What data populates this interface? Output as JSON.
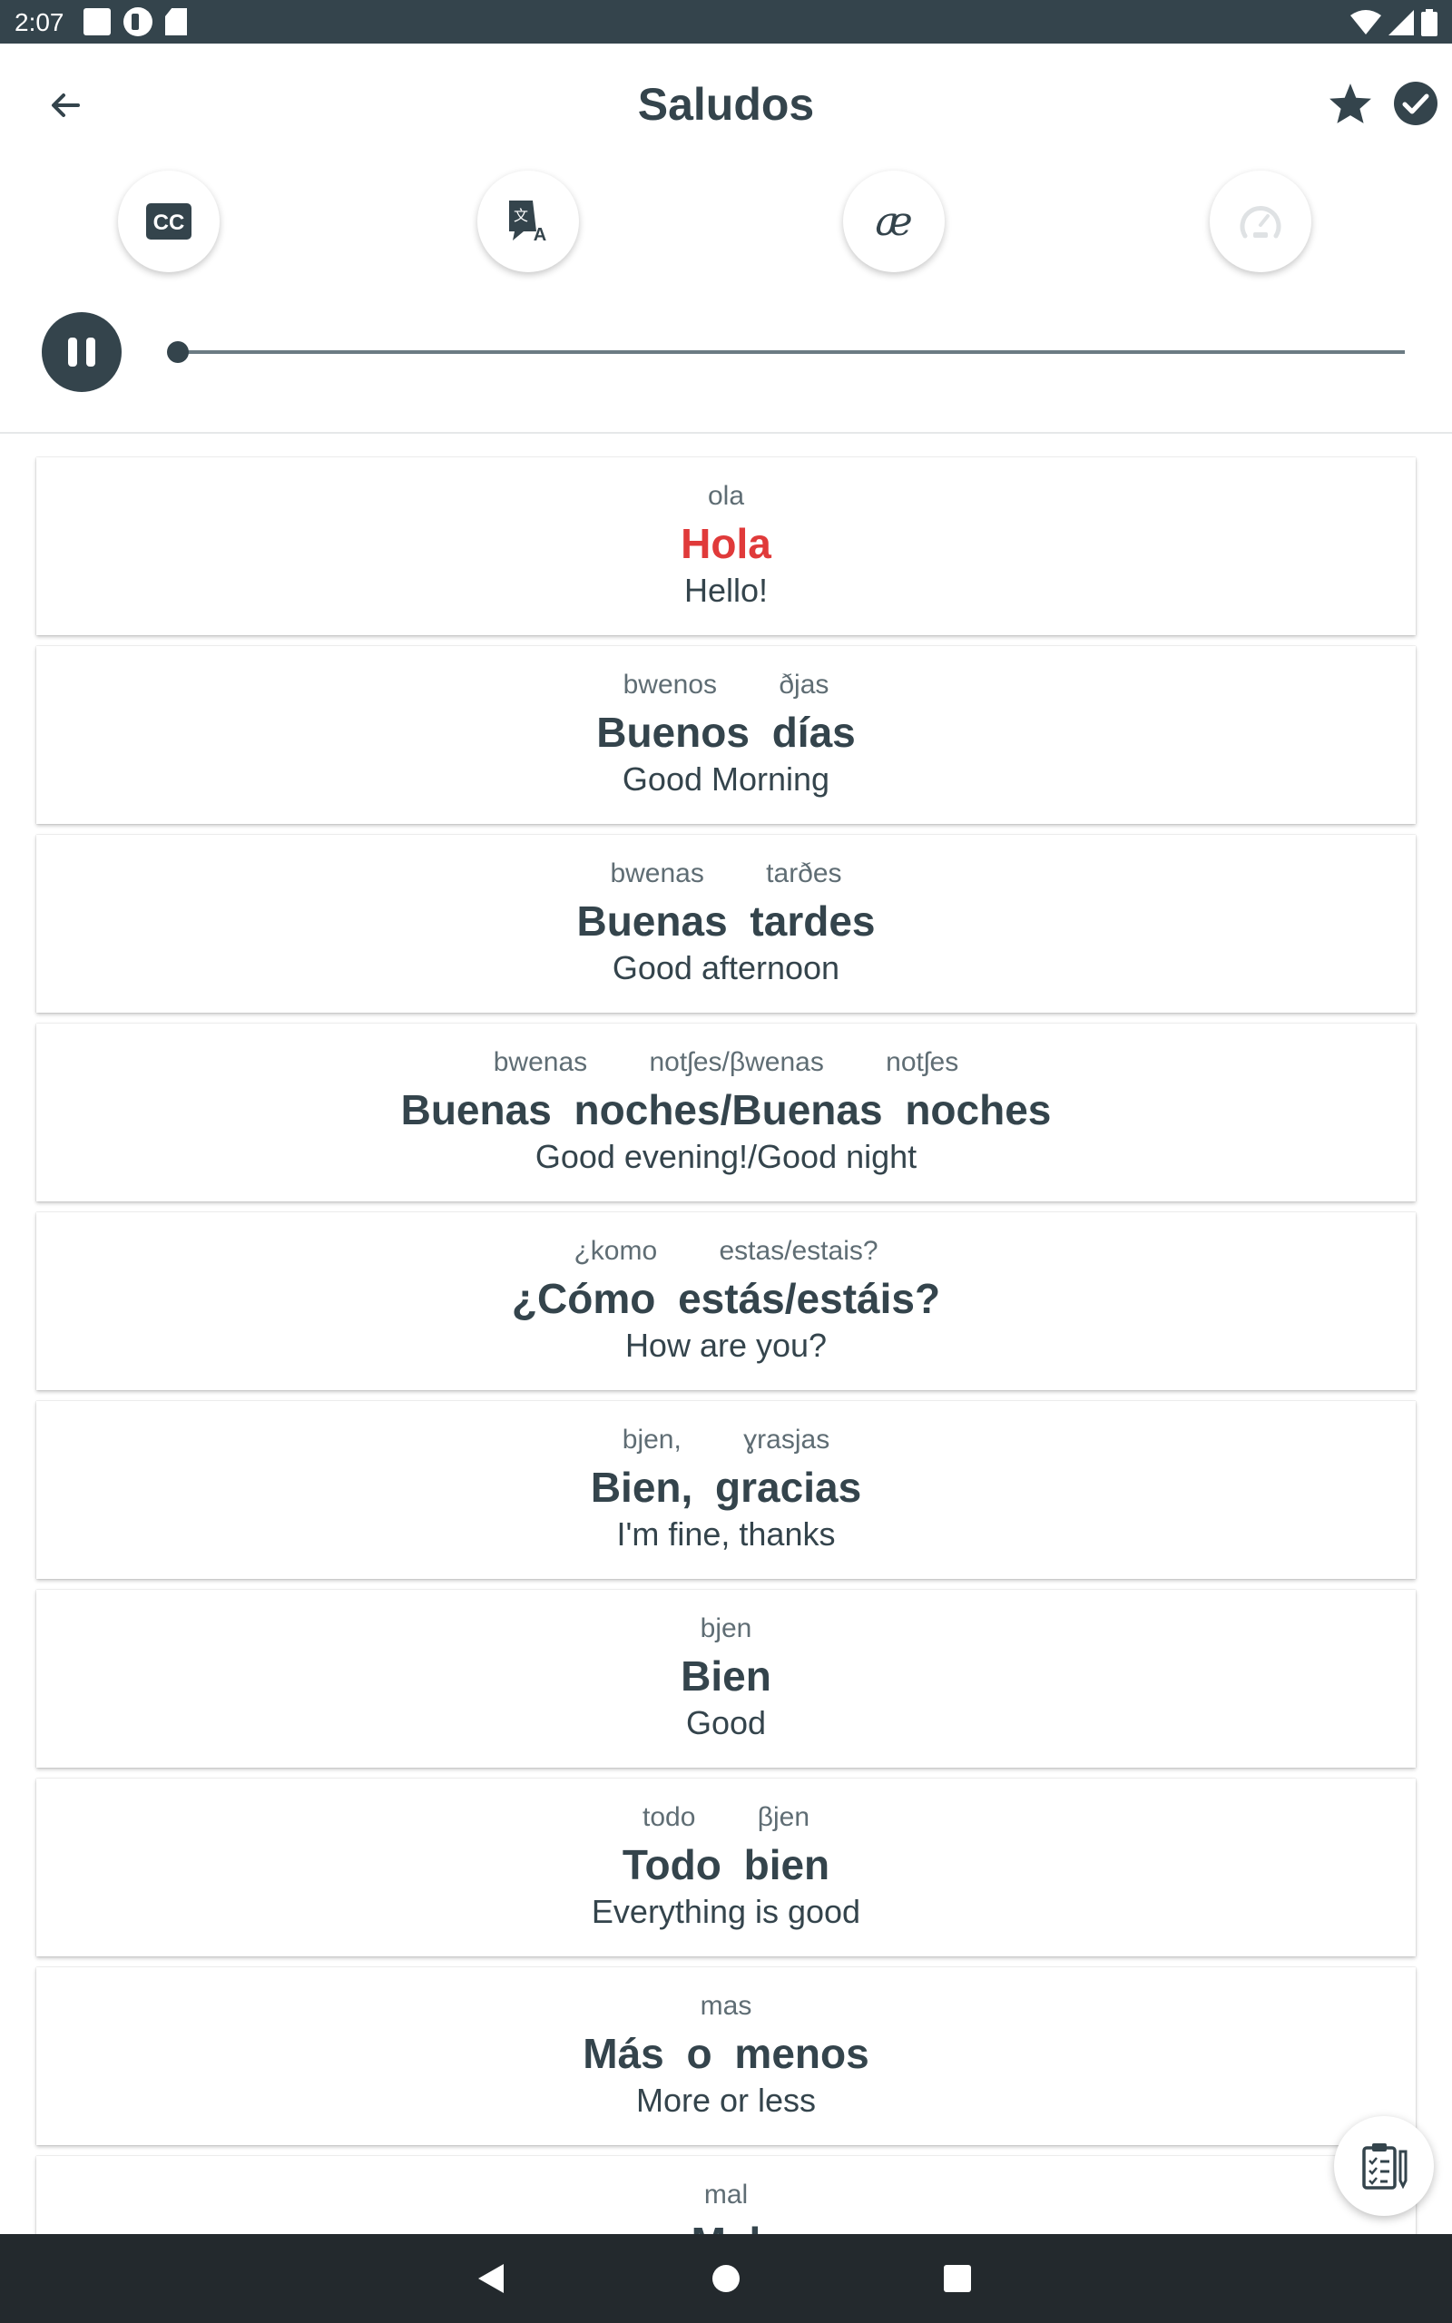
{
  "status_bar": {
    "time": "2:07",
    "icons_left": [
      "square-notification-icon",
      "app-notification-icon",
      "sd-card-icon"
    ],
    "icons_right": [
      "wifi-icon",
      "signal-icon",
      "battery-icon"
    ]
  },
  "header": {
    "title": "Saludos",
    "back_icon": "arrow-left-icon",
    "star_icon": "star-icon",
    "check_icon": "check-circle-icon"
  },
  "tools": [
    {
      "name": "closed-captions",
      "icon": "cc-icon"
    },
    {
      "name": "translate",
      "icon": "translate-icon"
    },
    {
      "name": "phonetics",
      "icon": "ae-icon",
      "glyph": "æ"
    },
    {
      "name": "speed",
      "icon": "speedometer-icon"
    }
  ],
  "player": {
    "state_icon": "pause-icon",
    "progress": 0.0
  },
  "phrases": [
    {
      "phonetic": "ola",
      "text": "Hola",
      "translation": "Hello!",
      "active": true
    },
    {
      "phonetic": "bwenos ðjas",
      "text": "Buenos días",
      "translation": "Good Morning"
    },
    {
      "phonetic": "bwenas tarðes",
      "text": "Buenas tardes",
      "translation": "Good afternoon"
    },
    {
      "phonetic": "bwenas notʃes/βwenas notʃes",
      "text": "Buenas noches/Buenas noches",
      "translation": "Good evening!/Good night"
    },
    {
      "phonetic": "¿komo estas/estais?",
      "text": "¿Cómo estás/estáis?",
      "translation": "How are you?"
    },
    {
      "phonetic": "bjen, ɣrasjas",
      "text": "Bien, gracias",
      "translation": "I'm fine, thanks"
    },
    {
      "phonetic": "bjen",
      "text": "Bien",
      "translation": "Good"
    },
    {
      "phonetic": "todo βjen",
      "text": "Todo bien",
      "translation": "Everything is good"
    },
    {
      "phonetic": "mas",
      "text": "Más o menos",
      "translation": "More or less"
    },
    {
      "phonetic": "mal",
      "text": "Mal",
      "translation": ""
    }
  ],
  "fab": {
    "icon": "clipboard-checklist-icon"
  },
  "nav": {
    "back_icon": "nav-back-icon",
    "home_icon": "nav-home-icon",
    "recents_icon": "nav-recents-icon"
  },
  "colors": {
    "primary": "#34444c",
    "active_word": "#e03a3a",
    "nav_bar": "#23292d"
  }
}
